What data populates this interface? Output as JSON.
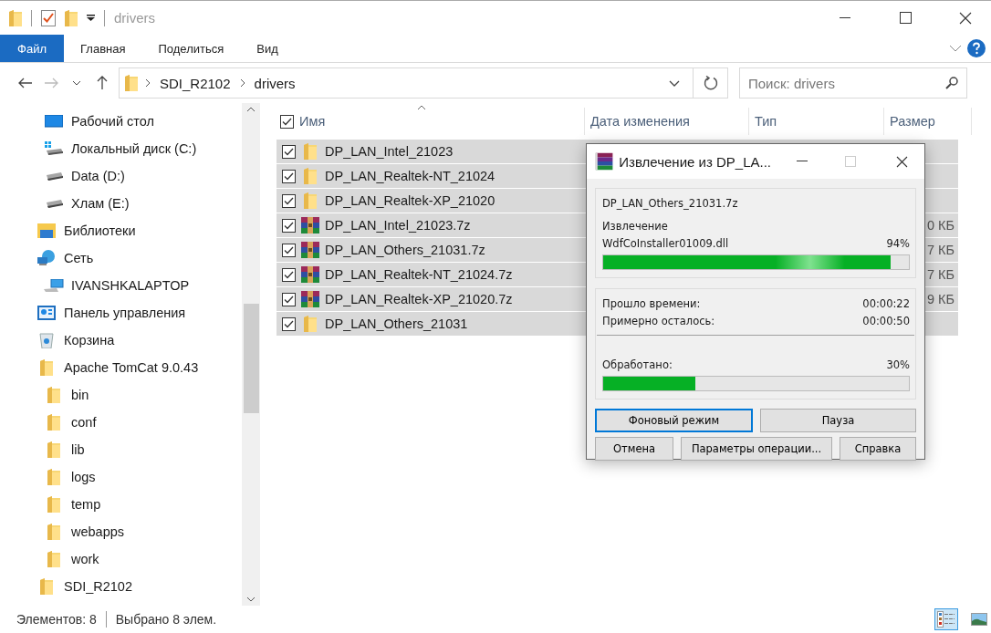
{
  "window": {
    "title": "drivers"
  },
  "ribbon_tabs": [
    {
      "label": "Файл",
      "selected": true
    },
    {
      "label": "Главная",
      "selected": false
    },
    {
      "label": "Поделиться",
      "selected": false
    },
    {
      "label": "Вид",
      "selected": false
    }
  ],
  "address_bar": {
    "path": [
      "SDI_R2102",
      "drivers"
    ]
  },
  "search": {
    "placeholder": "Поиск: drivers"
  },
  "sidebar": {
    "tree": [
      {
        "children": [
          {
            "label": "Рабочий стол",
            "kind": "desktop"
          },
          {
            "label": "Локальный диск (C:)",
            "kind": "system-drive"
          },
          {
            "label": "Data (D:)",
            "kind": "drive"
          },
          {
            "label": "Хлам (E:)",
            "kind": "drive"
          }
        ]
      },
      {
        "label": "Библиотеки",
        "kind": "library"
      },
      {
        "label": "Сеть",
        "kind": "network",
        "children": [
          {
            "label": "IVANSHKALAPTOP",
            "kind": "computer"
          }
        ]
      },
      {
        "label": "Панель управления",
        "kind": "control-panel"
      },
      {
        "label": "Корзина",
        "kind": "recycle-bin"
      },
      {
        "label": "Apache TomCat 9.0.43",
        "kind": "folder",
        "children": [
          {
            "label": "bin",
            "kind": "folder"
          },
          {
            "label": "conf",
            "kind": "folder"
          },
          {
            "label": "lib",
            "kind": "folder"
          },
          {
            "label": "logs",
            "kind": "folder"
          },
          {
            "label": "temp",
            "kind": "folder"
          },
          {
            "label": "webapps",
            "kind": "folder"
          },
          {
            "label": "work",
            "kind": "folder"
          }
        ]
      },
      {
        "label": "SDI_R2102",
        "kind": "folder"
      }
    ]
  },
  "file_list": {
    "all_checked": true,
    "columns": [
      "Имя",
      "Дата изменения",
      "Тип",
      "Размер"
    ],
    "rows": [
      {
        "name": "DP_LAN_Intel_21023",
        "kind": "folder",
        "checked": true,
        "selected": true
      },
      {
        "name": "DP_LAN_Realtek-NT_21024",
        "kind": "folder",
        "checked": true,
        "selected": true
      },
      {
        "name": "DP_LAN_Realtek-XP_21020",
        "kind": "folder",
        "checked": true,
        "selected": true
      },
      {
        "name": "DP_LAN_Intel_21023.7z",
        "kind": "archive",
        "checked": true,
        "selected": true,
        "size": "0 КБ"
      },
      {
        "name": "DP_LAN_Others_21031.7z",
        "kind": "archive",
        "checked": true,
        "selected": true,
        "size": "7 КБ"
      },
      {
        "name": "DP_LAN_Realtek-NT_21024.7z",
        "kind": "archive",
        "checked": true,
        "selected": true,
        "size": "7 КБ"
      },
      {
        "name": "DP_LAN_Realtek-XP_21020.7z",
        "kind": "archive",
        "checked": true,
        "selected": true,
        "size": "9 КБ"
      },
      {
        "name": "DP_LAN_Others_21031",
        "kind": "folder",
        "checked": true,
        "selected": true
      }
    ]
  },
  "status_bar": {
    "items": "Элементов: 8",
    "selected": "Выбрано 8 элем.",
    "views": [
      {
        "kind": "details",
        "selected": true
      },
      {
        "kind": "large-icons",
        "selected": false
      }
    ]
  },
  "dialog": {
    "title": "Извлечение из DP_LA...",
    "archive": "DP_LAN_Others_21031.7z",
    "operation": "Извлечение",
    "current_file": "WdfCoInstaller01009.dll",
    "file_percent": "94%",
    "file_progress": {
      "level": 0.94
    },
    "elapsed_label": "Прошло времени:",
    "elapsed": "00:00:22",
    "remaining_label": "Примерно осталось:",
    "remaining": "00:00:50",
    "processed_label": "Обработано:",
    "processed_percent": "30%",
    "total_progress": {
      "level": 0.3
    },
    "buttons": [
      [
        {
          "label": "Фоновый режим",
          "focused": true
        },
        {
          "label": "Пауза",
          "focused": false
        }
      ],
      [
        {
          "label": "Отмена",
          "focused": false
        },
        {
          "label": "Параметры операции...",
          "focused": false
        },
        {
          "label": "Справка",
          "focused": false
        }
      ]
    ]
  }
}
